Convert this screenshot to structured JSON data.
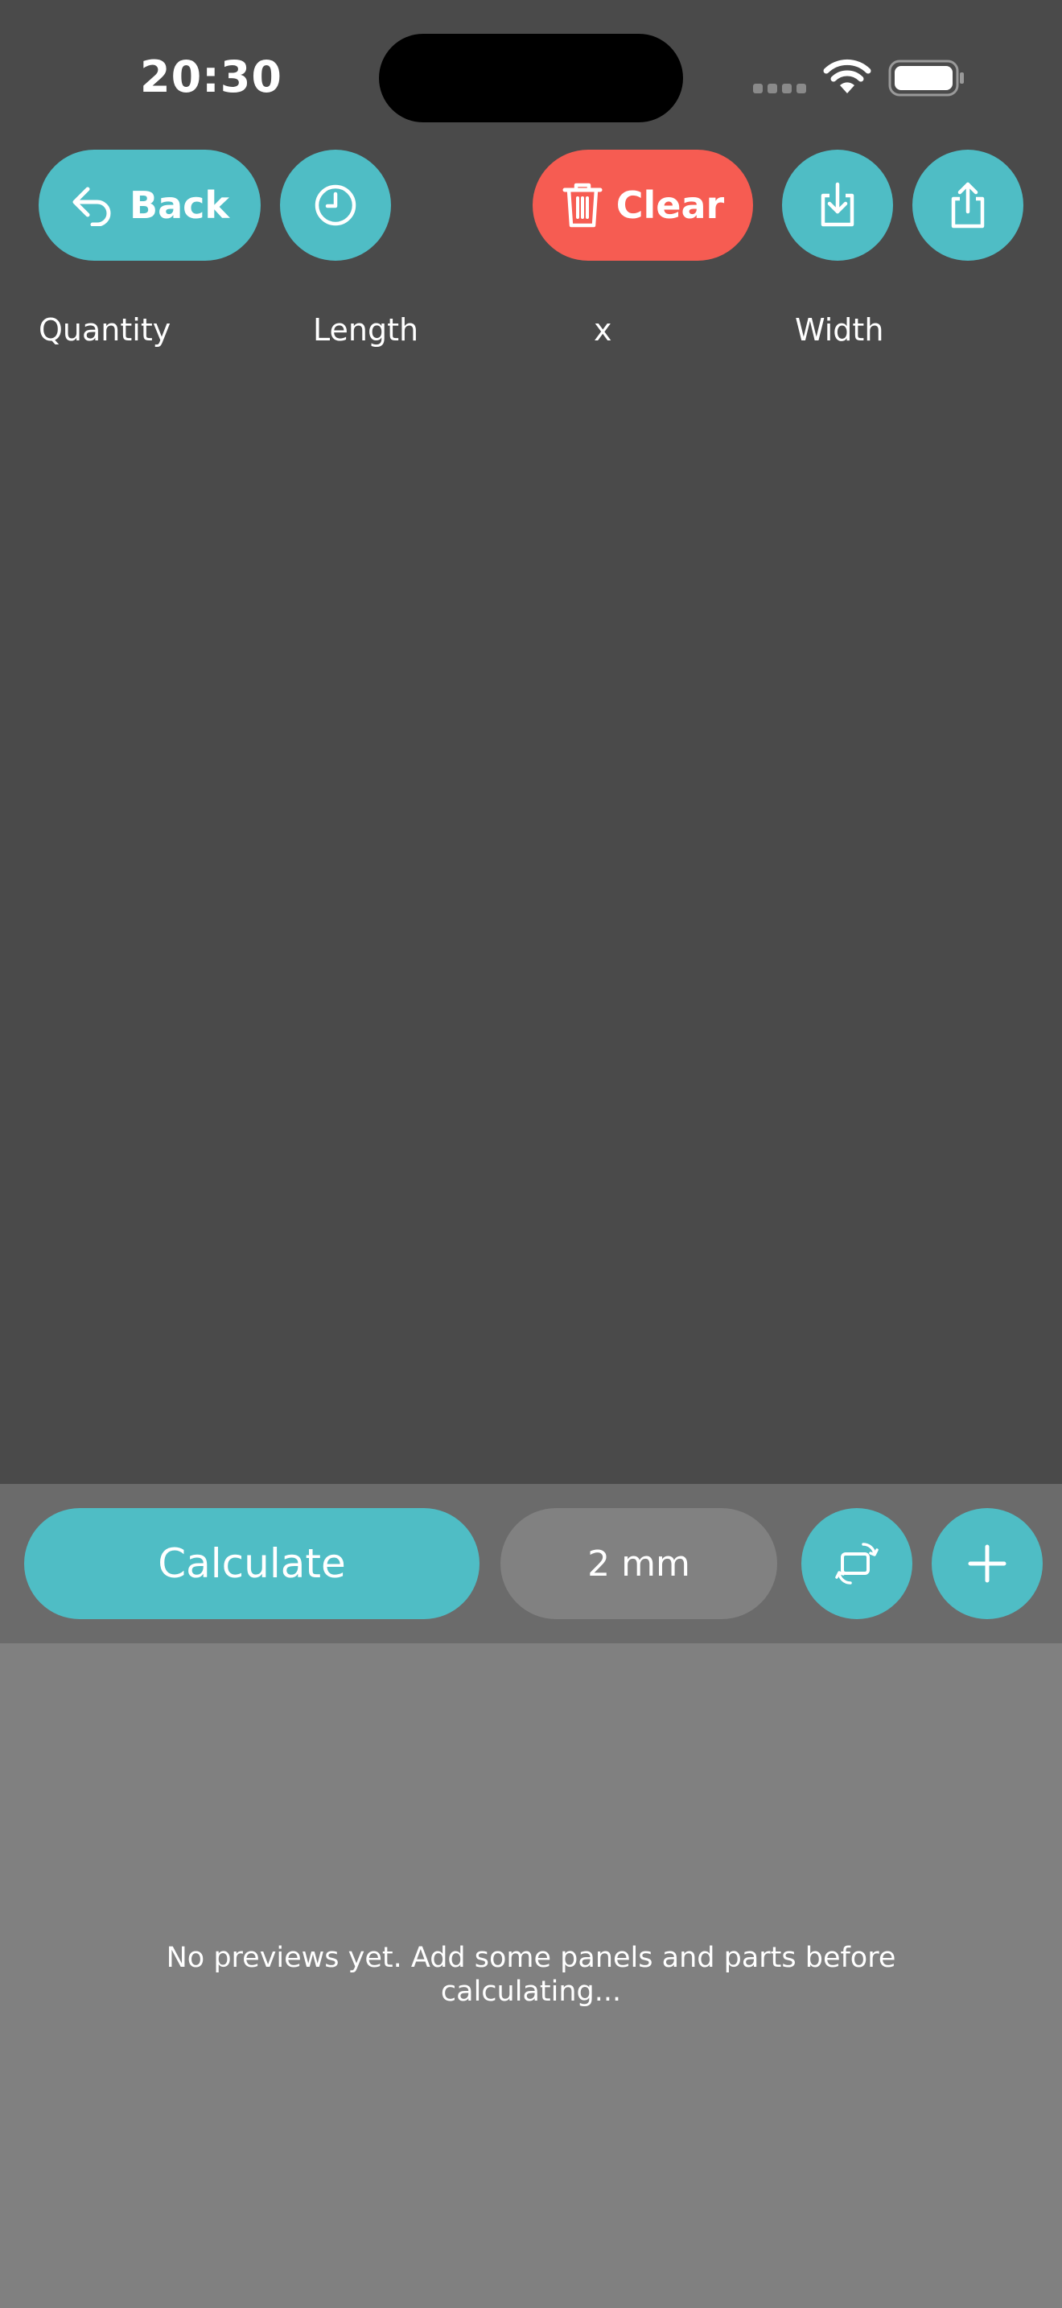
{
  "status_bar": {
    "time": "20:30"
  },
  "toolbar": {
    "back_label": "Back",
    "clear_label": "Clear"
  },
  "columns": {
    "quantity": "Quantity",
    "length": "Length",
    "separator": "x",
    "width": "Width"
  },
  "bottom_bar": {
    "calculate_label": "Calculate",
    "kerf_value": "2 mm"
  },
  "preview": {
    "empty_message": "No previews yet. Add some panels and parts before calculating..."
  },
  "colors": {
    "accent_teal": "#4fbdc5",
    "destructive_red": "#f65c52",
    "background_dark": "#4a4a4a",
    "bottom_bar_gray": "#6b6b6b",
    "preview_gray": "#808080",
    "field_gray": "#818181"
  },
  "icons": {
    "back": "back-arrow-icon",
    "history": "clock-icon",
    "clear": "trash-icon",
    "import": "download-tray-icon",
    "share": "share-icon",
    "rotate": "rotate-icon",
    "add": "plus-icon",
    "wifi": "wifi-icon",
    "battery": "battery-icon",
    "signal": "cellular-signal-icon"
  }
}
